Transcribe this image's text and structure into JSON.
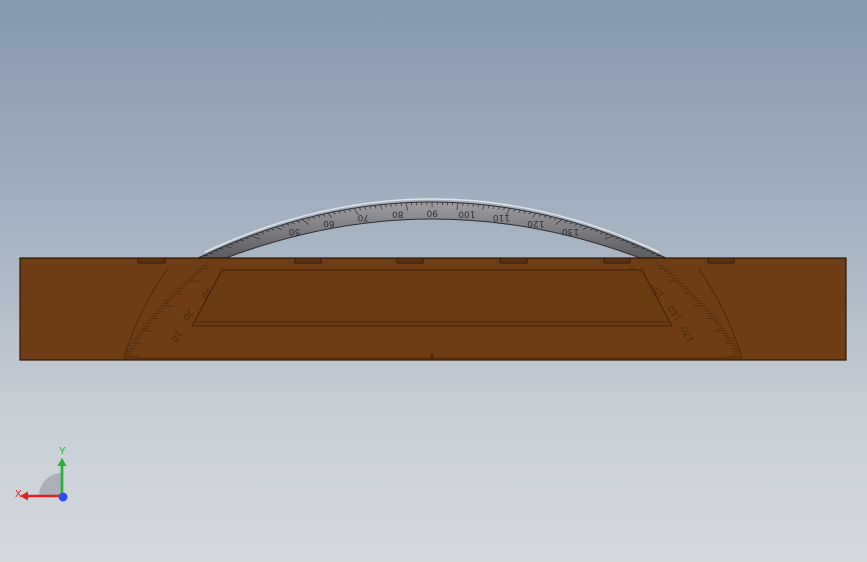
{
  "viewport": {
    "background_top": "#8797ab",
    "background_bottom": "#d4d9de"
  },
  "model": {
    "base_color": "#6e3d15",
    "edge_color": "#2d1603",
    "dial_color": "#6c6c6f",
    "dial_label_color": "#303033",
    "dial_labels": [
      "50",
      "60",
      "70",
      "80",
      "90",
      "100",
      "110",
      "120",
      "130"
    ],
    "base_labels_left": [
      "10",
      "20",
      "30",
      "40"
    ],
    "base_labels_right": [
      "140",
      "150",
      "160",
      "170"
    ]
  },
  "axes": {
    "x_label": "X",
    "y_label": "Y",
    "x_color": "#e62020",
    "y_color": "#22b234",
    "z_color": "#2b4df0",
    "x_icon": "arrow-left-icon",
    "y_icon": "arrow-up-icon",
    "z_icon": "dot-icon"
  }
}
